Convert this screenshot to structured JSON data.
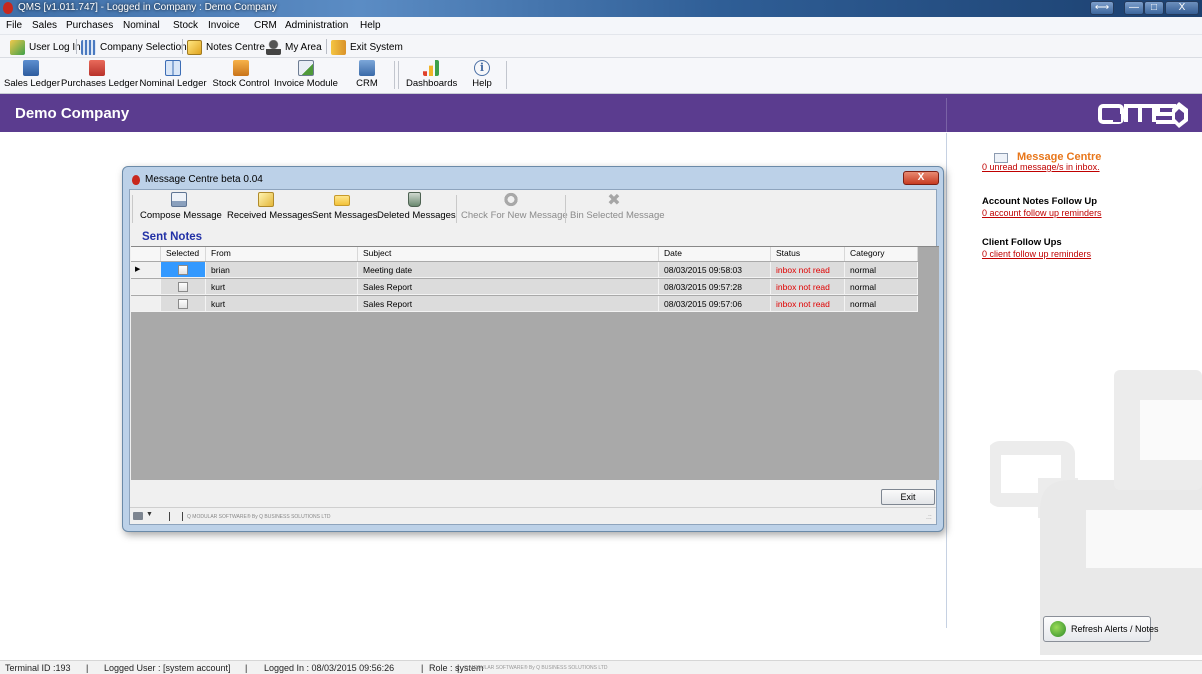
{
  "window": {
    "title": "QMS  [v1.011.747]  -  Logged in Company : Demo Company",
    "restore_label": "⟷",
    "minimize_label": "—",
    "maximize_label": "□",
    "close_label": "X"
  },
  "menu": [
    "File",
    "Sales",
    "Purchases",
    "Nominal",
    "Stock",
    "Invoice",
    "CRM",
    "Administration",
    "Help"
  ],
  "quickbar": [
    {
      "label": "User Log In",
      "icon": "user-login-icon"
    },
    {
      "label": "Company Selection",
      "icon": "company-selection-icon"
    },
    {
      "label": "Notes Centre",
      "icon": "notes-centre-icon"
    },
    {
      "label": "My Area",
      "icon": "my-area-icon"
    },
    {
      "label": "Exit System",
      "icon": "exit-system-icon"
    }
  ],
  "modules": [
    {
      "label": "Sales Ledger",
      "icon": "sales-ledger-icon"
    },
    {
      "label": "Purchases Ledger",
      "icon": "purchases-ledger-icon"
    },
    {
      "label": "Nominal Ledger",
      "icon": "nominal-ledger-icon"
    },
    {
      "label": "Stock Control",
      "icon": "stock-control-icon"
    },
    {
      "label": "Invoice Module",
      "icon": "invoice-module-icon"
    },
    {
      "label": "CRM",
      "icon": "crm-icon"
    },
    {
      "label": "Dashboards",
      "icon": "dashboards-icon"
    },
    {
      "label": "Help",
      "icon": "help-icon"
    }
  ],
  "banner": {
    "company": "Demo Company"
  },
  "right_panel": {
    "message_centre_title": "Message Centre",
    "unread_link": "0 unread message/s in inbox.",
    "account_heading": "Account Notes Follow Up",
    "account_link": "0 account follow up reminders",
    "client_heading": "Client Follow Ups",
    "client_link": "0 client follow up reminders",
    "refresh_label": "Refresh Alerts / Notes"
  },
  "status": {
    "terminal": "Terminal ID :193",
    "user": "Logged User : [system account]",
    "logged_in": "Logged In : 08/03/2015 09:56:26",
    "role": "Role : system",
    "copyright": "Q MODULAR SOFTWARE® By Q BUSINESS SOLUTIONS LTD"
  },
  "dialog": {
    "title": "Message Centre beta 0.04",
    "close_label": "X",
    "toolbar": [
      {
        "label": "Compose Message",
        "icon": "compose-message-icon",
        "enabled": true
      },
      {
        "label": "Received Messages",
        "icon": "received-messages-icon",
        "enabled": true
      },
      {
        "label": "Sent Messages",
        "icon": "sent-messages-icon",
        "enabled": true
      },
      {
        "label": "Deleted Messages",
        "icon": "deleted-messages-icon",
        "enabled": true
      },
      {
        "label": "Check For New Message",
        "icon": "check-new-message-icon",
        "enabled": false
      },
      {
        "label": "Bin Selected Message",
        "icon": "bin-message-icon",
        "enabled": false
      }
    ],
    "section_title": "Sent Notes",
    "columns": [
      "Selected",
      "From",
      "Subject",
      "Date",
      "Status",
      "Category"
    ],
    "rows": [
      {
        "from": "brian",
        "subject": "Meeting date",
        "date": "08/03/2015 09:58:03",
        "status": "inbox not read",
        "category": "normal",
        "current": true
      },
      {
        "from": "kurt",
        "subject": "Sales Report",
        "date": "08/03/2015 09:57:28",
        "status": "inbox not read",
        "category": "normal",
        "current": false
      },
      {
        "from": "kurt",
        "subject": "Sales Report",
        "date": "08/03/2015 09:57:06",
        "status": "inbox not read",
        "category": "normal",
        "current": false
      }
    ],
    "exit_label": "Exit",
    "footer_copyright": "Q MODULAR SOFTWARE® By Q BUSINESS SOLUTIONS LTD",
    "current_row_marker": "▶",
    "print_arrow": "▼",
    "grip": ".::"
  },
  "colors": {
    "banner": "#5b3c8f",
    "accent_orange": "#e8761a",
    "link_red": "#c00000",
    "status_red": "#e00000",
    "section_blue": "#2231a6",
    "selection_blue": "#3399ff"
  }
}
